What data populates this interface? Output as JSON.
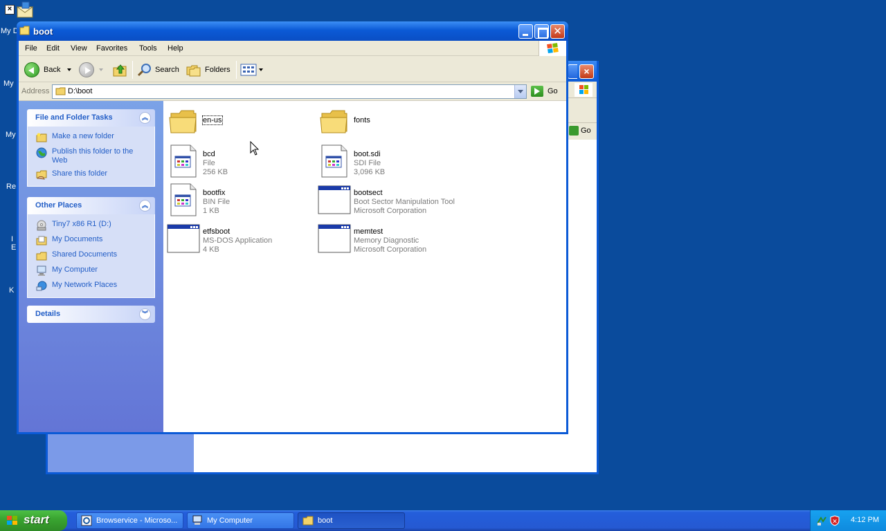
{
  "desktop": {
    "icon_labels": [
      "My D",
      "My",
      "My",
      "Re",
      "I",
      "E",
      "K"
    ]
  },
  "window": {
    "title": "boot",
    "menu": [
      "File",
      "Edit",
      "View",
      "Favorites",
      "Tools",
      "Help"
    ],
    "toolbar": {
      "back_label": "Back",
      "search_label": "Search",
      "folders_label": "Folders"
    },
    "address": {
      "label": "Address",
      "value": "D:\\boot",
      "go_label": "Go"
    }
  },
  "background_window": {
    "go_label": "Go"
  },
  "taskpane": {
    "file_tasks": {
      "title": "File and Folder Tasks",
      "links": [
        "Make a new folder",
        "Publish this folder to the Web",
        "Share this folder"
      ]
    },
    "other_places": {
      "title": "Other Places",
      "links": [
        "Tiny7 x86 R1 (D:)",
        "My Documents",
        "Shared Documents",
        "My Computer",
        "My Network Places"
      ]
    },
    "details": {
      "title": "Details"
    }
  },
  "files": [
    {
      "name": "en-us",
      "type": "folder",
      "lines": []
    },
    {
      "name": "fonts",
      "type": "folder",
      "lines": []
    },
    {
      "name": "bcd",
      "type": "file",
      "lines": [
        "File",
        "256 KB"
      ]
    },
    {
      "name": "boot.sdi",
      "type": "file",
      "lines": [
        "SDI File",
        "3,096 KB"
      ]
    },
    {
      "name": "bootfix",
      "type": "file",
      "lines": [
        "BIN File",
        "1 KB"
      ]
    },
    {
      "name": "bootsect",
      "type": "app",
      "lines": [
        "Boot Sector Manipulation Tool",
        "Microsoft Corporation"
      ]
    },
    {
      "name": "etfsboot",
      "type": "app",
      "lines": [
        "MS-DOS Application",
        "4 KB"
      ]
    },
    {
      "name": "memtest",
      "type": "app",
      "lines": [
        "Memory Diagnostic",
        "Microsoft Corporation"
      ]
    }
  ],
  "taskbar": {
    "start_label": "start",
    "tasks": [
      "Browservice - Microso...",
      "My Computer",
      "boot"
    ],
    "clock": "4:12 PM"
  },
  "colors": {
    "desktop": "#0a4b9c",
    "titlebar": "#0b5ad6",
    "link": "#215dc6"
  }
}
